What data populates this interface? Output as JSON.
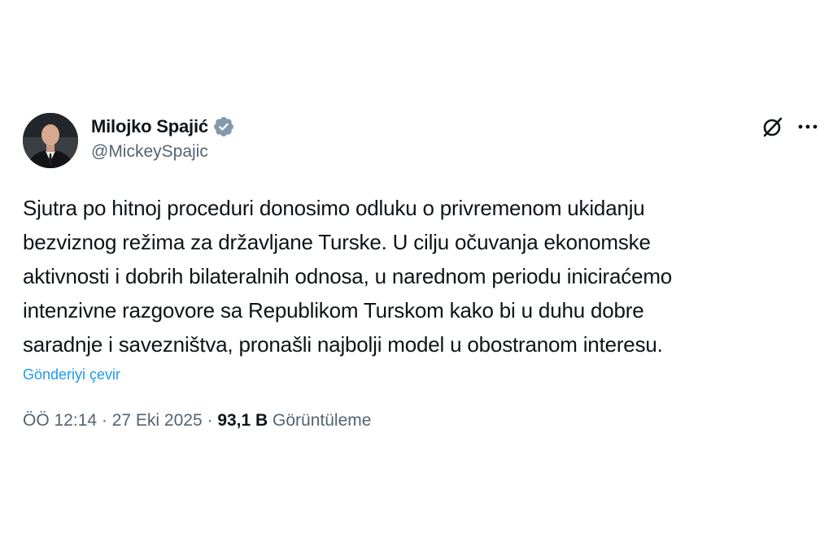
{
  "author": {
    "display_name": "Milojko Spajić",
    "handle": "@MickeySpajic",
    "verified": true,
    "verified_color": "#829aab",
    "avatar_icon": "profile-photo"
  },
  "actions": {
    "grok_icon": "grok-icon",
    "more_icon": "more-icon"
  },
  "post": {
    "lines": [
      "Sjutra po hitnoj proceduri donosimo odluku o privremenom ukidanju",
      "bezviznog režima za državljane Turske. U cilju očuvanja ekonomske",
      "aktivnosti i dobrih bilateralnih odnosa, u narednom periodu iniciraćemo",
      "intenzivne razgovore sa Republikom Turskom kako bi u duhu dobre",
      "saradnje i savezništva, pronašli najbolji model u obostranom interesu."
    ],
    "translate_label": "Gönderiyi çevir"
  },
  "meta": {
    "time": "ÖÖ 12:14",
    "separator": " · ",
    "date": "27 Eki 2025",
    "views_count": "93,1 B",
    "views_label": "Görüntüleme"
  },
  "colors": {
    "link": "#1d9bf0",
    "secondary_text": "#536471",
    "primary_text": "#0f1419"
  }
}
